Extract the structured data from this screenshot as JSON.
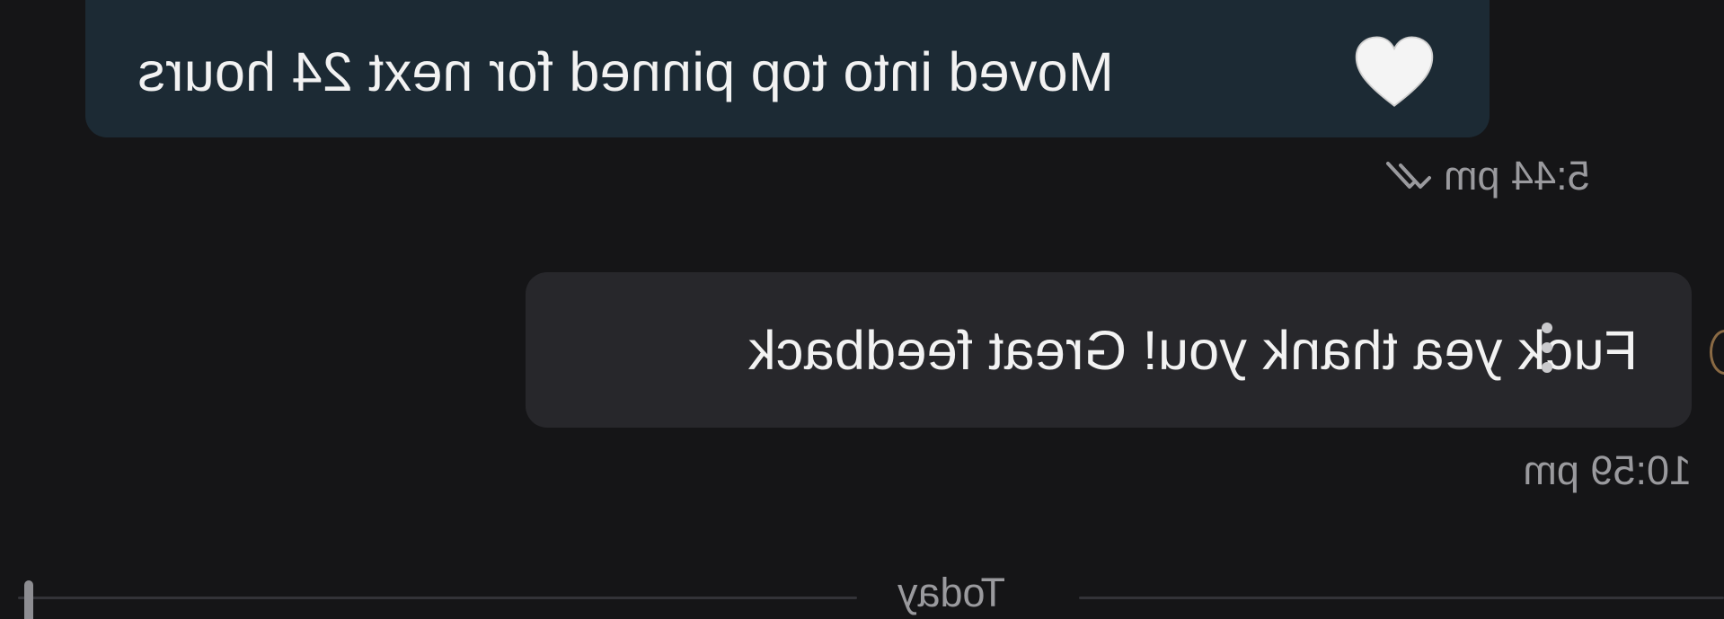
{
  "messages": [
    {
      "direction": "sent",
      "text": "Moved into top pinned for next 24 hours",
      "emoji": "white-heart",
      "time": "5:44 pm",
      "status_icon": "double-check-icon"
    },
    {
      "direction": "received",
      "text": "Fuck yea thank you! Great feedback",
      "time": "10:59 pm"
    }
  ],
  "divider": {
    "label": "Today"
  },
  "colors": {
    "background": "#151517",
    "sent_bubble": "#1c2a34",
    "received_bubble": "#27272b",
    "meta_text": "#9a9a9e"
  }
}
